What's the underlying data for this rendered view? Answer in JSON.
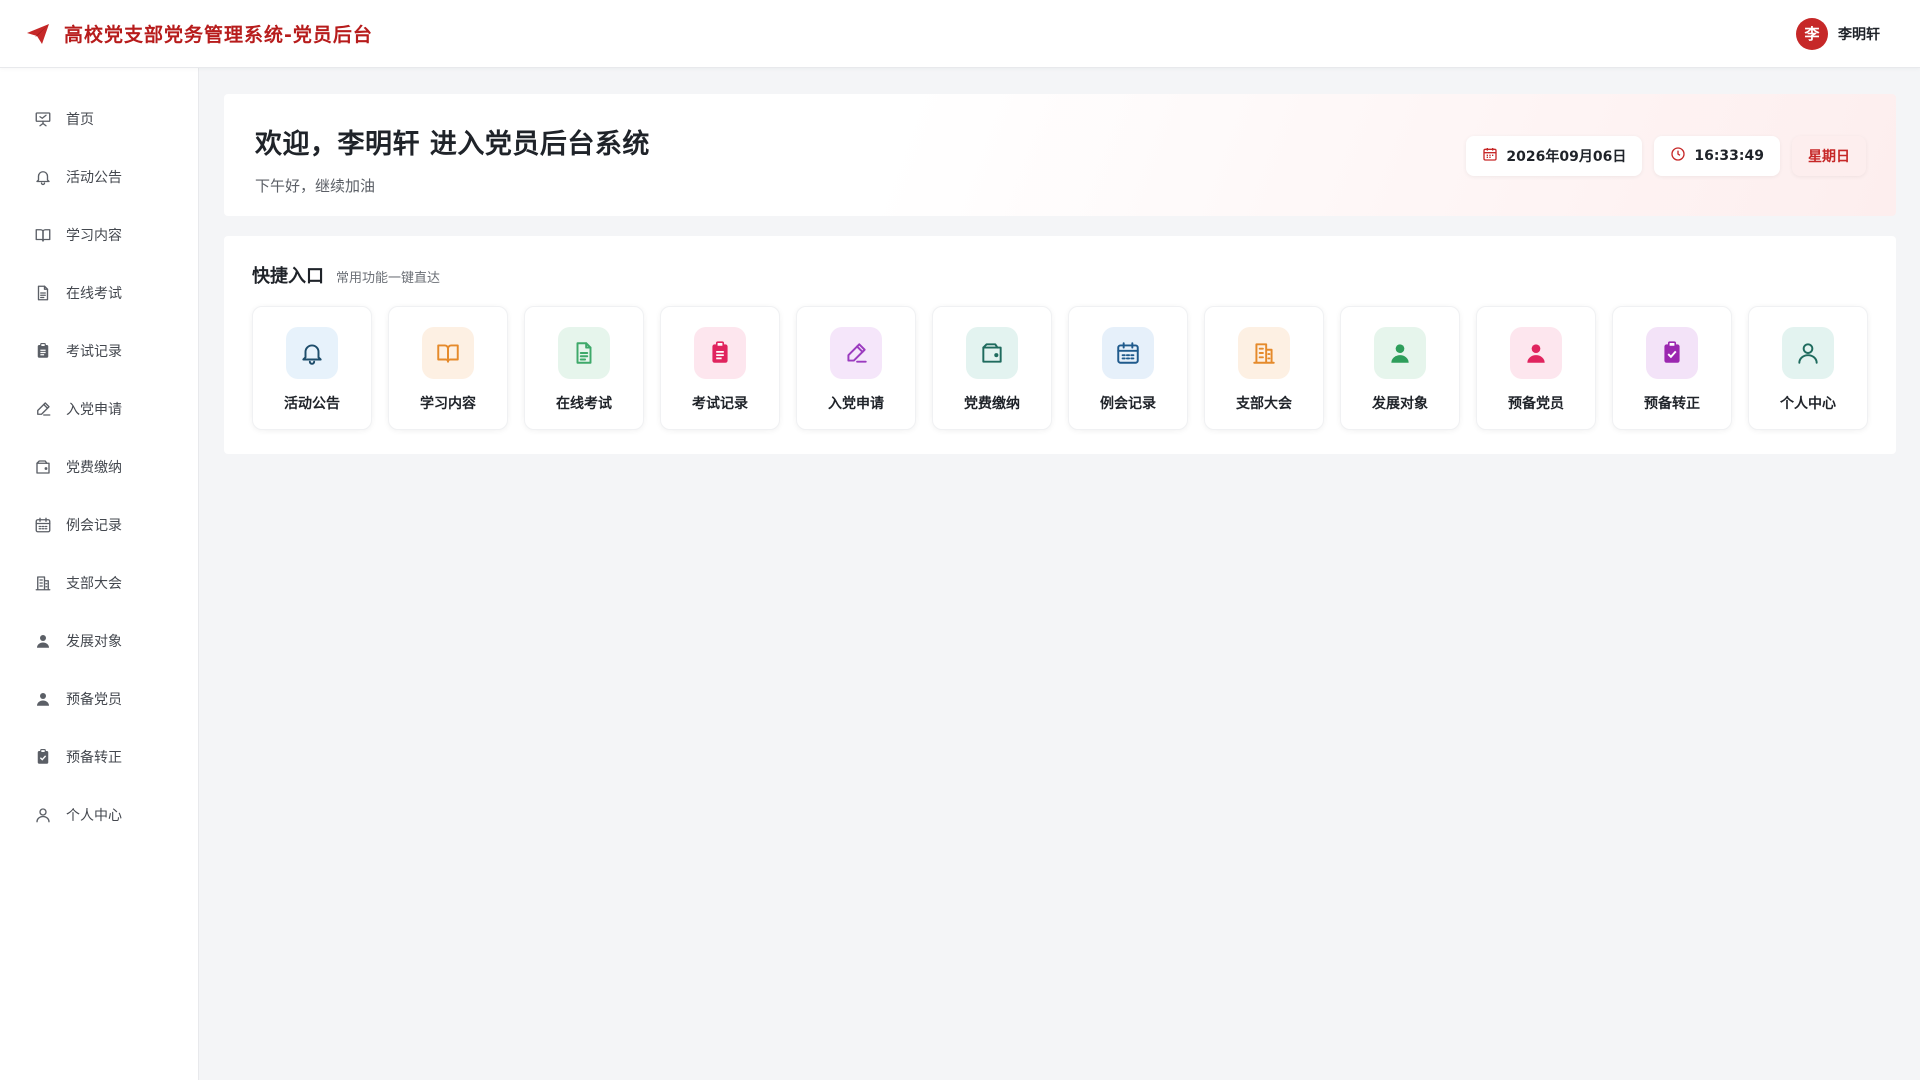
{
  "header": {
    "title": "高校党支部党务管理系统-党员后台",
    "brand_color": "#b71c1c"
  },
  "user": {
    "avatar_text": "李",
    "name": "李明轩"
  },
  "sidebar": {
    "items": [
      {
        "label": "首页",
        "icon": "presentation-icon"
      },
      {
        "label": "活动公告",
        "icon": "bell-icon"
      },
      {
        "label": "学习内容",
        "icon": "book-icon"
      },
      {
        "label": "在线考试",
        "icon": "document-icon"
      },
      {
        "label": "考试记录",
        "icon": "clipboard-icon"
      },
      {
        "label": "入党申请",
        "icon": "pen-icon"
      },
      {
        "label": "党费缴纳",
        "icon": "wallet-icon"
      },
      {
        "label": "例会记录",
        "icon": "calendar-icon"
      },
      {
        "label": "支部大会",
        "icon": "building-icon"
      },
      {
        "label": "发展对象",
        "icon": "person-icon"
      },
      {
        "label": "预备党员",
        "icon": "person-icon"
      },
      {
        "label": "预备转正",
        "icon": "clipboard-check-icon"
      },
      {
        "label": "个人中心",
        "icon": "user-outline-icon"
      }
    ]
  },
  "welcome": {
    "title": "欢迎，李明轩 进入党员后台系统",
    "subtitle": "下午好，继续加油",
    "date": "2026年09月06日",
    "time": "16:33:49",
    "weekday": "星期日"
  },
  "quick": {
    "title": "快捷入口",
    "subtitle": "常用功能一键直达",
    "tiles": [
      {
        "label": "活动公告",
        "icon": "bell-icon",
        "color": "#1e4d6b",
        "bg": "#e7f2fb"
      },
      {
        "label": "学习内容",
        "icon": "book-icon",
        "color": "#e58a2b",
        "bg": "#fdf0e3"
      },
      {
        "label": "在线考试",
        "icon": "document-icon",
        "color": "#3ea96a",
        "bg": "#e6f5ec"
      },
      {
        "label": "考试记录",
        "icon": "clipboard-icon",
        "color": "#e0245e",
        "bg": "#fde6ee"
      },
      {
        "label": "入党申请",
        "icon": "pen-icon",
        "color": "#9b3bbf",
        "bg": "#f5e6fa"
      },
      {
        "label": "党费缴纳",
        "icon": "wallet-icon",
        "color": "#1f6b5e",
        "bg": "#e3f3f0"
      },
      {
        "label": "例会记录",
        "icon": "calendar-icon",
        "color": "#1f5a8c",
        "bg": "#e6f0fa"
      },
      {
        "label": "支部大会",
        "icon": "building-icon",
        "color": "#e58a2b",
        "bg": "#fdf0e3"
      },
      {
        "label": "发展对象",
        "icon": "person-icon",
        "color": "#2e9e5b",
        "bg": "#e6f5ec"
      },
      {
        "label": "预备党员",
        "icon": "person-icon",
        "color": "#e0245e",
        "bg": "#fde6ee"
      },
      {
        "label": "预备转正",
        "icon": "clipboard-check-icon",
        "color": "#9b27b0",
        "bg": "#f3e3f8"
      },
      {
        "label": "个人中心",
        "icon": "user-outline-icon",
        "color": "#1f6b5e",
        "bg": "#e3f3f0"
      }
    ]
  }
}
